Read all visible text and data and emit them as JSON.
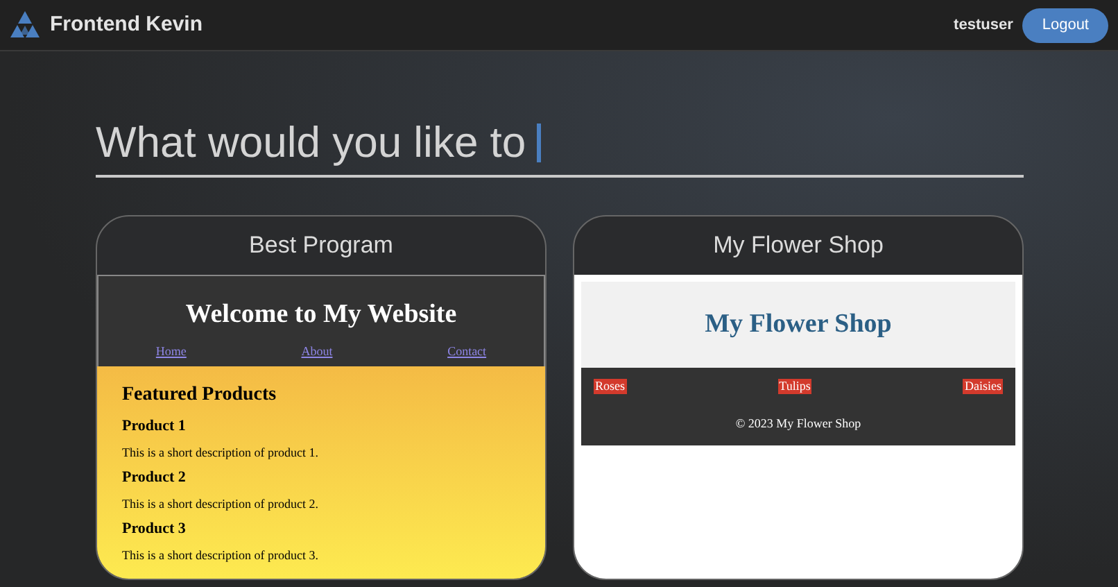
{
  "header": {
    "brand": "Frontend Kevin",
    "username": "testuser",
    "logout": "Logout"
  },
  "prompt": {
    "text": "What would you like to"
  },
  "cards": [
    {
      "title": "Best Program",
      "kind": "products",
      "preview": {
        "heading": "Welcome to My Website",
        "nav": [
          "Home",
          "About",
          "Contact"
        ],
        "section": "Featured Products",
        "products": [
          {
            "name": "Product 1",
            "description": "This is a short description of product 1."
          },
          {
            "name": "Product 2",
            "description": "This is a short description of product 2."
          },
          {
            "name": "Product 3",
            "description": "This is a short description of product 3."
          }
        ]
      }
    },
    {
      "title": "My Flower Shop",
      "kind": "shop",
      "preview": {
        "heading": "My Flower Shop",
        "nav": [
          "Roses",
          "Tulips",
          "Daisies"
        ],
        "footer": "© 2023 My Flower Shop"
      }
    }
  ]
}
